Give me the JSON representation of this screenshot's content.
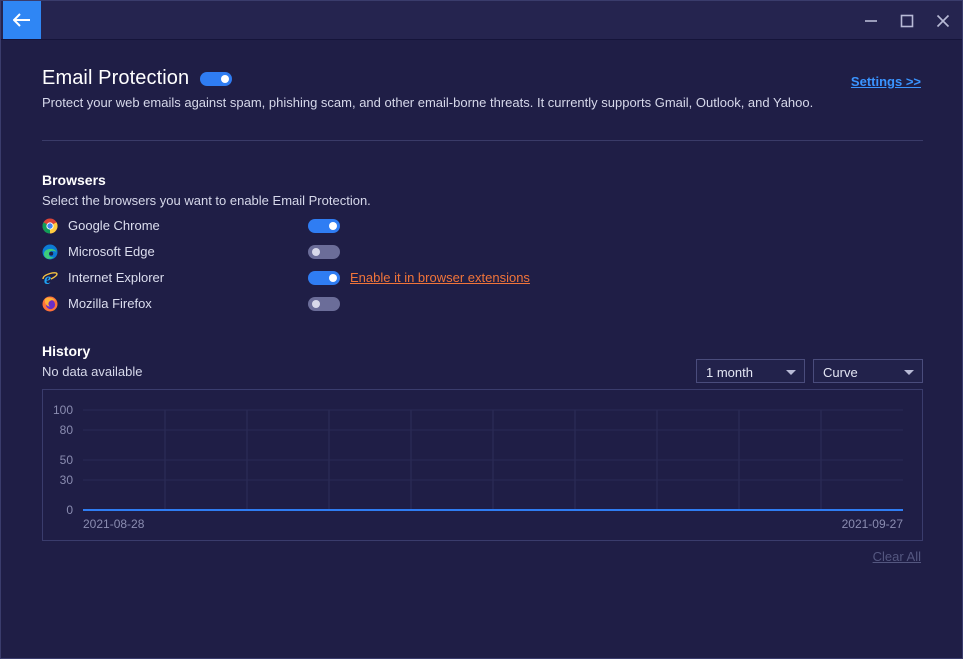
{
  "window": {
    "back_icon": "arrow-left-icon",
    "controls": [
      "minimize-icon",
      "maximize-icon",
      "close-icon"
    ]
  },
  "header": {
    "title": "Email Protection",
    "enabled": true,
    "settings_link": "Settings >>",
    "description": "Protect your web emails against spam, phishing scam, and other email-borne threats. It currently supports Gmail, Outlook, and Yahoo."
  },
  "browsers": {
    "title": "Browsers",
    "description": "Select the browsers you want to enable Email Protection.",
    "items": [
      {
        "name": "Google Chrome",
        "icon": "chrome-icon",
        "enabled": true,
        "note": ""
      },
      {
        "name": "Microsoft Edge",
        "icon": "edge-icon",
        "enabled": false,
        "note": ""
      },
      {
        "name": "Internet Explorer",
        "icon": "ie-icon",
        "enabled": true,
        "note": "Enable it in browser extensions"
      },
      {
        "name": "Mozilla Firefox",
        "icon": "firefox-icon",
        "enabled": false,
        "note": ""
      }
    ]
  },
  "history": {
    "title": "History",
    "status": "No data available",
    "range_select": "1 month",
    "type_select": "Curve",
    "clear_all": "Clear All"
  },
  "colors": {
    "accent": "#2f7df3",
    "link": "#3a94ff",
    "warning_link": "#f0743a",
    "background": "#1f1e46"
  },
  "chart_data": {
    "type": "line",
    "x": [
      "2021-08-28",
      "2021-09-27"
    ],
    "x_tick_labels": [
      "2021-08-28",
      "2021-09-27"
    ],
    "y_ticks": [
      0,
      30,
      50,
      80,
      100
    ],
    "ylim": [
      0,
      100
    ],
    "series": [
      {
        "values": [
          0,
          0
        ]
      }
    ],
    "grid": true
  }
}
